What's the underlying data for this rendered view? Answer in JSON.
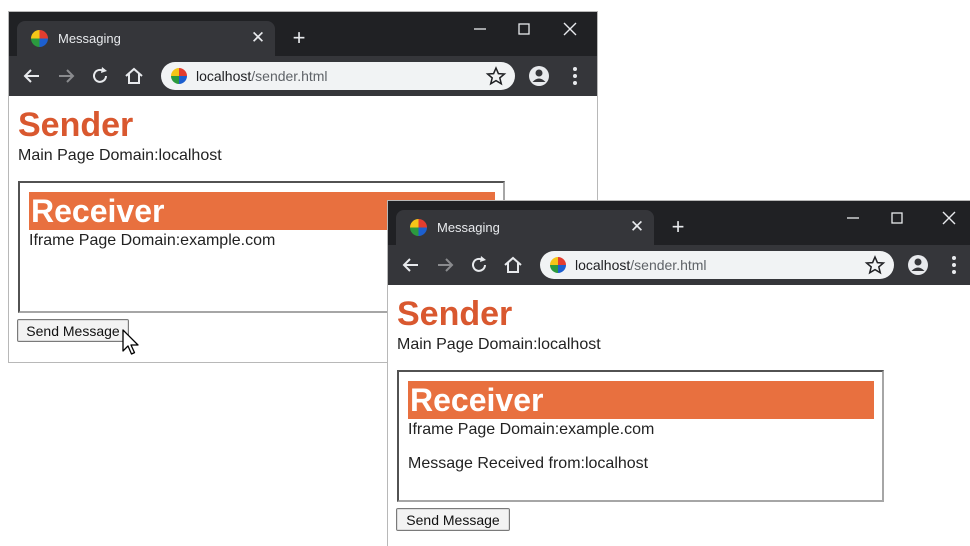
{
  "windows": [
    {
      "tab": {
        "title": "Messaging",
        "close_icon": "close-icon"
      },
      "new_tab_icon": "plus-icon",
      "address": {
        "host": "localhost",
        "path": "/sender.html"
      },
      "page": {
        "heading": "Sender",
        "domain_line": "Main Page Domain:localhost",
        "iframe": {
          "heading": "Receiver",
          "domain_line": "Iframe Page Domain:example.com",
          "message_line": ""
        },
        "button_label": "Send Message"
      },
      "cursor": "arrow-cursor"
    },
    {
      "tab": {
        "title": "Messaging",
        "close_icon": "close-icon"
      },
      "new_tab_icon": "plus-icon",
      "address": {
        "host": "localhost",
        "path": "/sender.html"
      },
      "page": {
        "heading": "Sender",
        "domain_line": "Main Page Domain:localhost",
        "iframe": {
          "heading": "Receiver",
          "domain_line": "Iframe Page Domain:example.com",
          "message_line": "Message Received from:localhost"
        },
        "button_label": "Send Message"
      }
    }
  ],
  "colors": {
    "titlebar": "#202124",
    "toolbar": "#35363a",
    "heading": "#d9582f",
    "receiver_bar": "#e8703f"
  }
}
